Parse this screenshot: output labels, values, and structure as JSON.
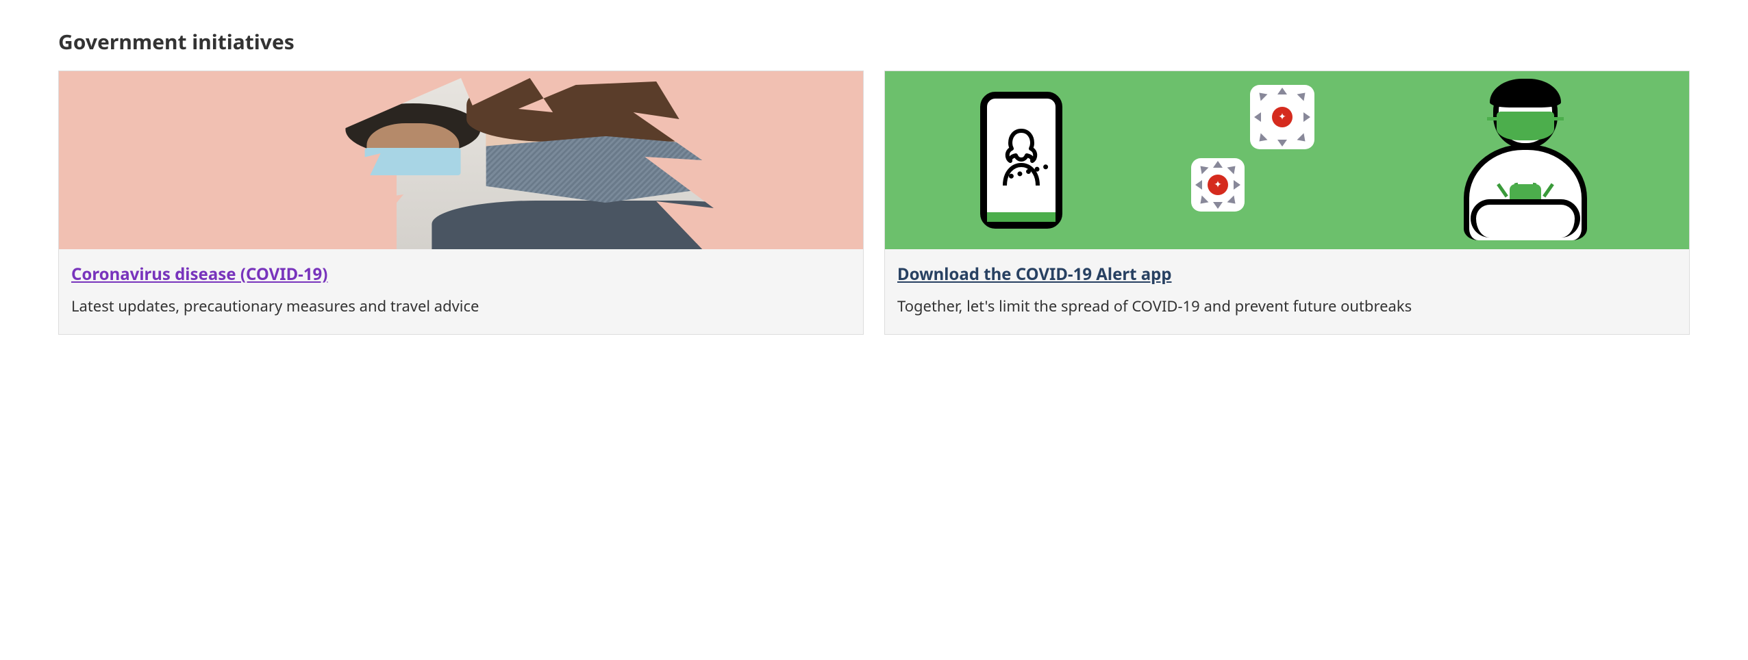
{
  "section": {
    "title": "Government initiatives"
  },
  "cards": [
    {
      "link_text": "Coronavirus disease (COVID-19)",
      "description": "Latest updates, precautionary measures and travel advice",
      "link_state": "visited",
      "image_alt": "People wearing face masks with maple leaf cutout"
    },
    {
      "link_text": "Download the COVID-19 Alert app",
      "description": "Together, let's limit the spread of COVID-19 and prevent future outbreaks",
      "link_state": "normal",
      "image_alt": "Illustration of phone alert app notifying a masked person"
    }
  ],
  "colors": {
    "visited_link": "#7834bc",
    "normal_link": "#284162",
    "card_bg": "#f5f5f5",
    "img1_bg": "#f1c0b2",
    "img2_bg": "#6cc06c",
    "accent_red": "#d52b1e",
    "accent_green": "#4cae4c"
  }
}
